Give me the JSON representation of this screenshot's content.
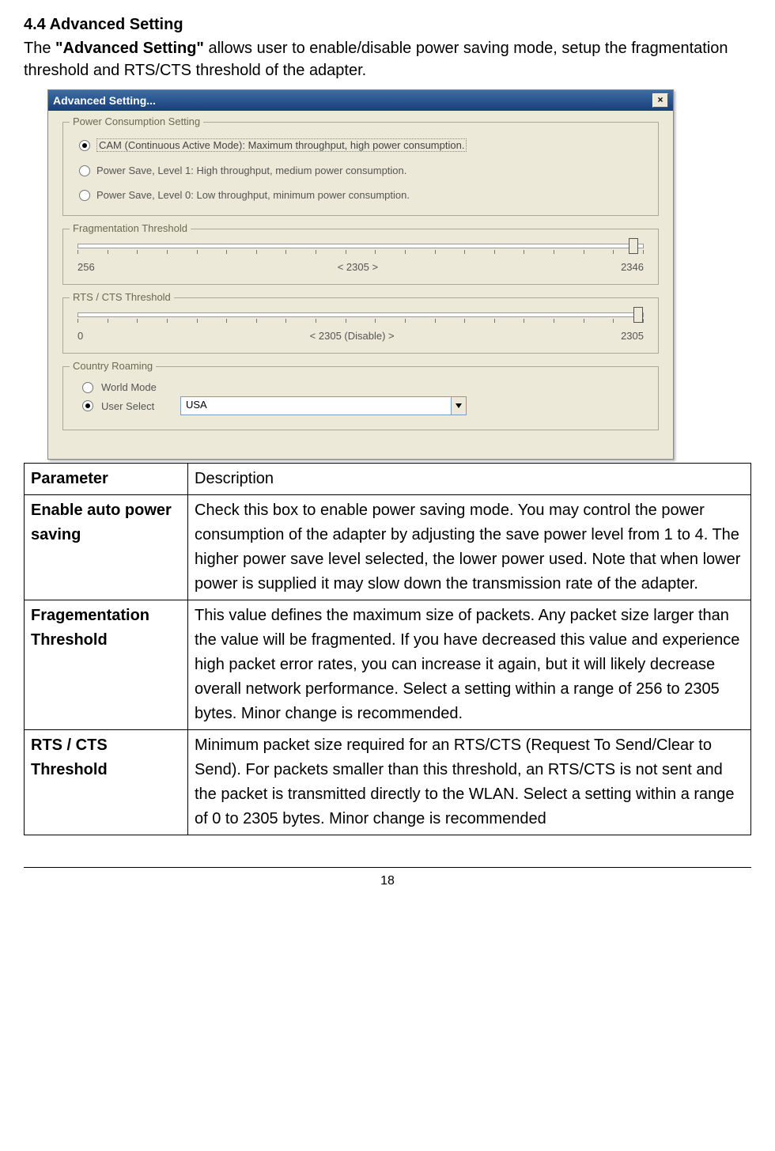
{
  "heading": "4.4 Advanced Setting",
  "intro_pre": "  The ",
  "intro_bold": "\"Advanced Setting\"",
  "intro_post": " allows user to enable/disable power saving mode, setup the fragmentation threshold and RTS/CTS threshold of the adapter.",
  "dialog": {
    "title": "Advanced Setting...",
    "close": "×",
    "group_power": "Power Consumption Setting",
    "opt_cam": "CAM (Continuous Active Mode): Maximum throughput, high power consumption.",
    "opt_ps1": "Power Save, Level 1: High throughput, medium power consumption.",
    "opt_ps0": "Power Save, Level 0: Low throughput, minimum power consumption.",
    "group_frag": "Fragmentation Threshold",
    "frag_min": "256",
    "frag_val": "< 2305 >",
    "frag_max": "2346",
    "group_rts": "RTS / CTS Threshold",
    "rts_min": "0",
    "rts_val": "< 2305 (Disable) >",
    "rts_max": "2305",
    "group_country": "Country Roaming",
    "opt_world": "World Mode",
    "opt_user": "User Select",
    "country_value": "USA"
  },
  "table": {
    "h_param": "Parameter",
    "h_desc": "Description",
    "r1_param": "Enable auto power saving",
    "r1_desc": "  Check this box to enable power saving mode. You may control the power consumption of the adapter by adjusting the save power level from 1 to 4. The higher power save level selected, the lower power used. Note that when lower power is supplied it may slow down the transmission rate of the adapter.",
    "r2_param": "Fragementation Threshold",
    "r2_desc": "  This value defines the maximum size of packets.   Any packet size larger than the value will be fragmented. If you have decreased this value and experience high packet error rates, you can increase it again, but it will likely decrease overall network performance. Select a setting within a range of 256 to 2305 bytes. Minor change is recommended.",
    "r3_param": "RTS / CTS Threshold",
    "r3_desc": "  Minimum packet size required for an RTS/CTS (Request To Send/Clear to Send). For packets smaller than this threshold, an RTS/CTS is not sent and the packet is transmitted directly to the WLAN. Select a setting within a range of 0 to 2305 bytes. Minor change is recommended"
  },
  "page_number": "18"
}
